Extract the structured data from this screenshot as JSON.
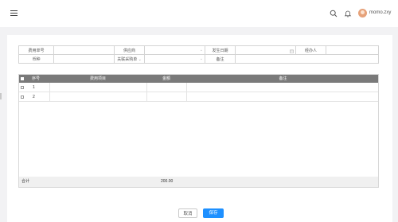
{
  "header": {
    "user_name": "momo.zxy"
  },
  "form": {
    "row1": {
      "expense_no_label": "费用单号",
      "expense_no_value": "",
      "supplier_label": "供应商",
      "supplier_value": "",
      "date_label": "发生日期",
      "date_value": "",
      "handler_label": "经办人",
      "handler_value": ""
    },
    "row2": {
      "currency_label": "币种",
      "currency_value": "",
      "related_order_label": "关联采购单",
      "related_order_value": "",
      "remark_label": "备注",
      "remark_value": ""
    }
  },
  "table": {
    "columns": {
      "index": "序号",
      "item": "费用项目",
      "amount": "金额",
      "remark": "备注"
    },
    "rows": [
      {
        "index": "1",
        "item": "",
        "amount": "",
        "remark": ""
      },
      {
        "index": "2",
        "item": "",
        "amount": "",
        "remark": ""
      }
    ],
    "footer": {
      "label": "合计",
      "amount": "200.00"
    }
  },
  "actions": {
    "cancel": "取消",
    "save": "保存"
  },
  "colors": {
    "primary": "#1e90ff",
    "table_header": "#7a7a7a"
  }
}
